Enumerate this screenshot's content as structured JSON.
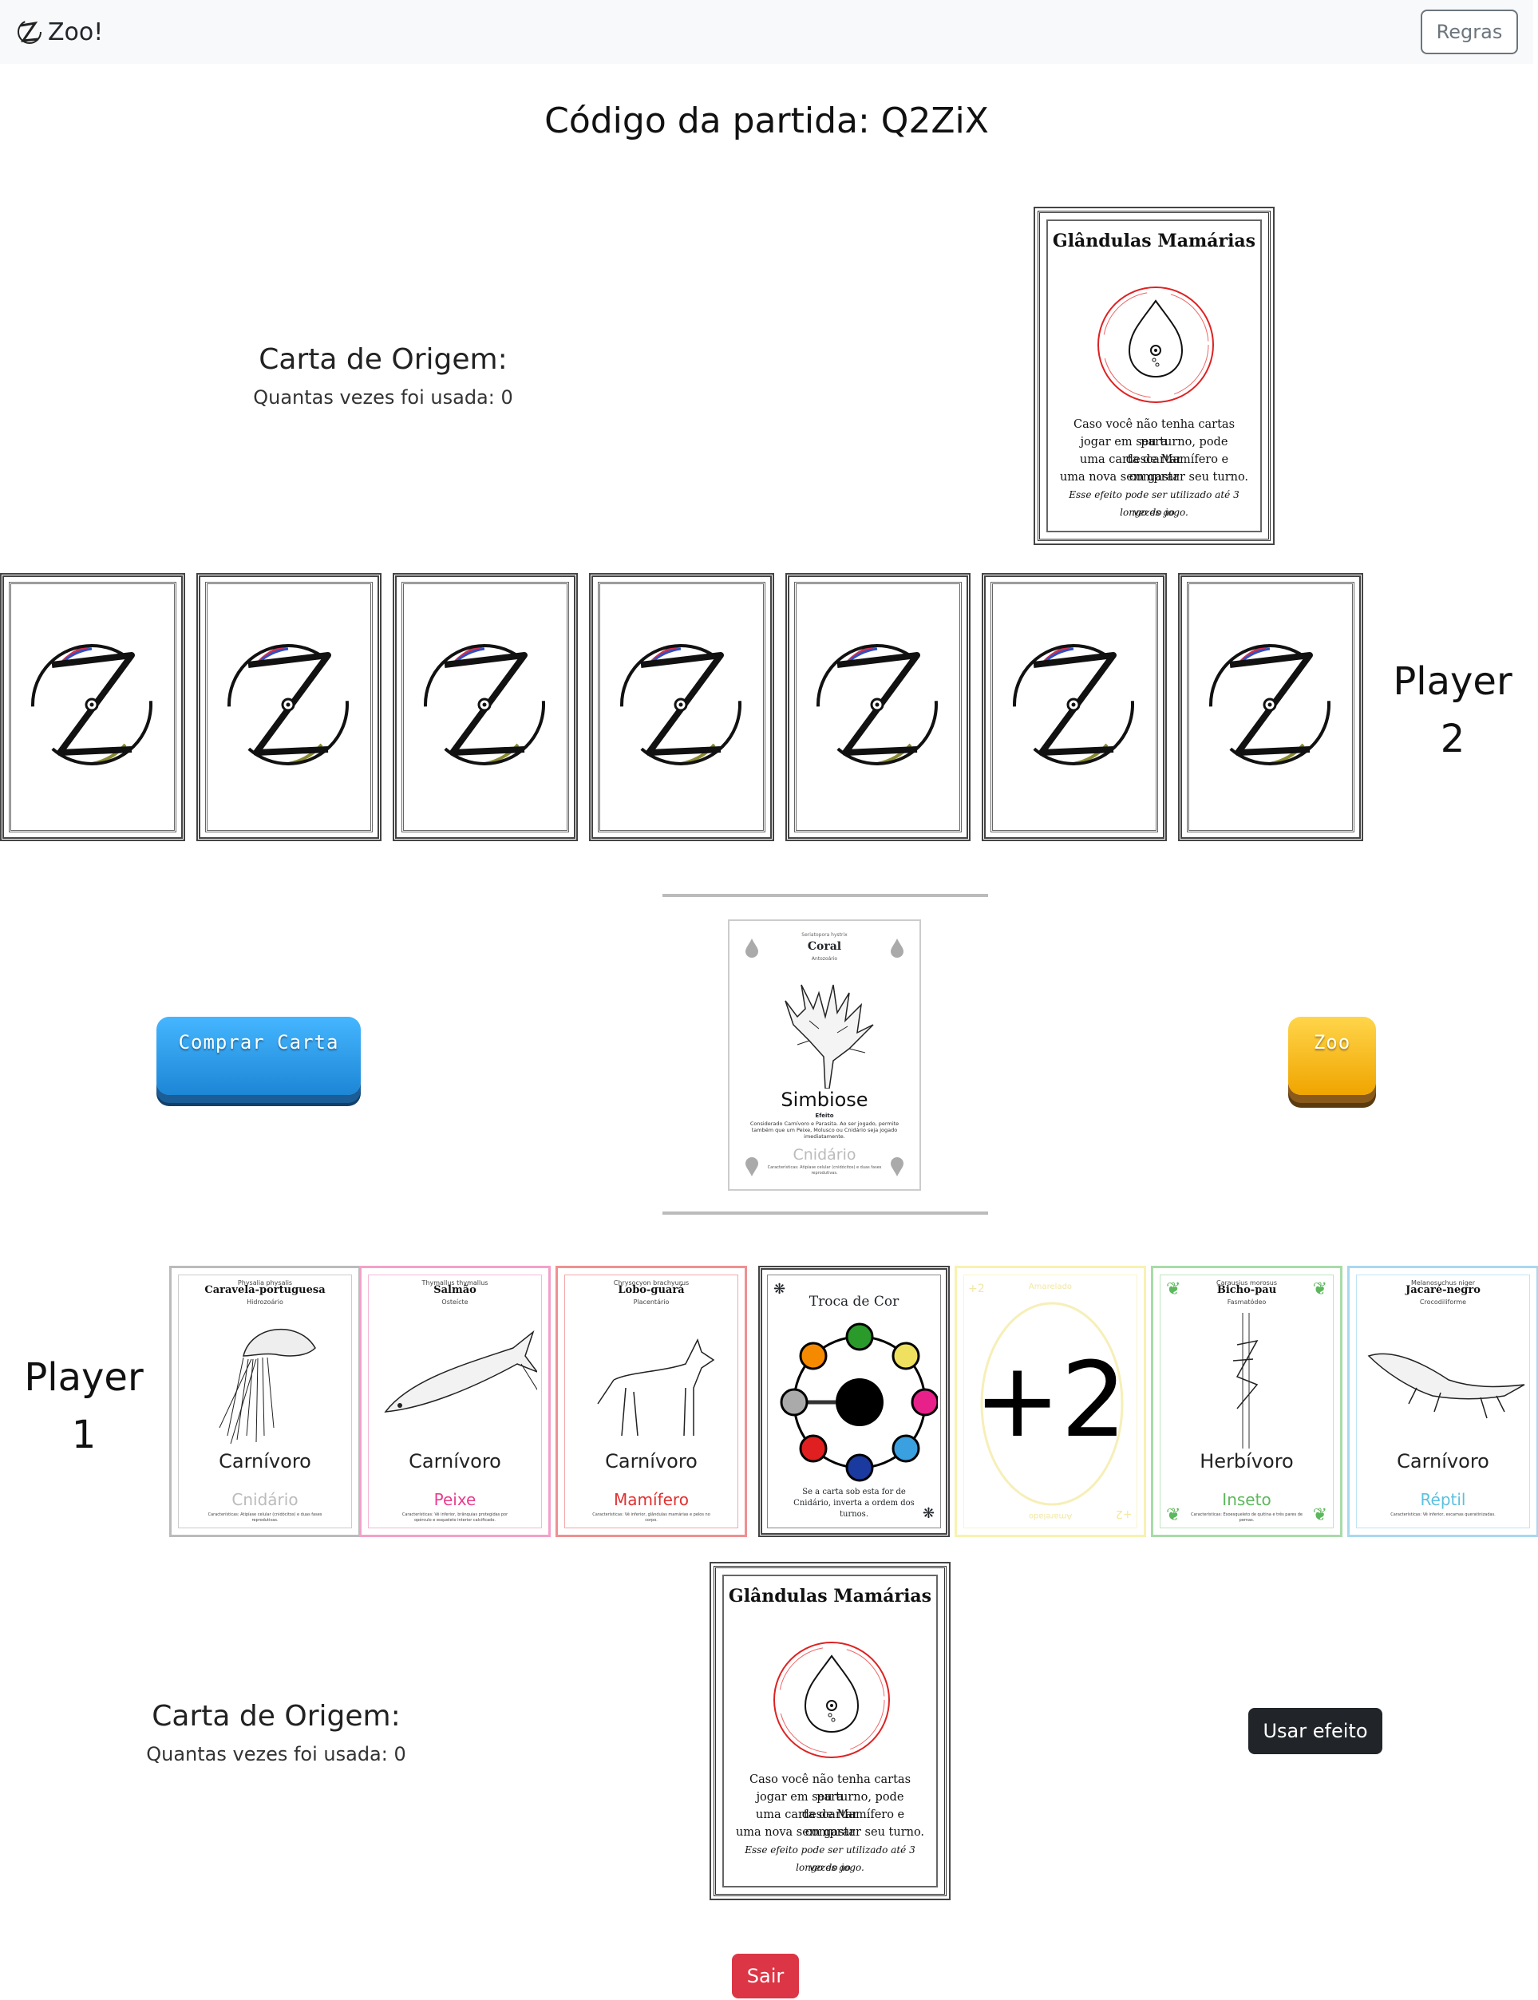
{
  "navbar": {
    "brand": "Zoo!",
    "rules_button": "Regras"
  },
  "match": {
    "code_label": "Código da partida: Q2ZiX"
  },
  "player2": {
    "name": "Player 2",
    "name_line1": "Player",
    "name_line2": "2",
    "hand_count": 7,
    "origin": {
      "title": "Carta de Origem:",
      "usage": "Quantas vezes foi usada: 0",
      "card": {
        "title": "Glândulas Mamárias",
        "text_lines": [
          "Caso você não tenha cartas para",
          "jogar em seu turno, pode descartar",
          "uma carta de Mamífero e comprar",
          "uma nova sem gastar seu turno."
        ],
        "italic_lines": [
          "Esse efeito pode ser utilizado até 3 vezes ao",
          "longo do jogo."
        ]
      }
    }
  },
  "table": {
    "buy_button": "Comprar Carta",
    "zoo_button": "Zoo",
    "top_card": {
      "sci_top": "Seriatopora hystrix",
      "name": "Coral",
      "subclass": "Antozoário",
      "effect_name": "Simbiose",
      "effect_label": "Efeito",
      "effect_text": "Considerado Carnívoro e Parasita. Ao ser jogado, permite também que um Peixe, Molusco ou Cnidário seja jogado imediatamente.",
      "class": "Cnidário",
      "class_desc": "Características: Atipíase celular (cnidócitos) e duas fases reprodutivas."
    }
  },
  "player1": {
    "name_line1": "Player",
    "name_line2": "1",
    "hand": [
      {
        "sci": "Physalia physalis",
        "name": "Caravela-portuguesa",
        "sub": "Hidrozoário",
        "diet": "Carnívoro",
        "class": "Cnidário",
        "desc": "Características: Atipíase celular (cnidócitos) e duas fases reprodutivas.",
        "color": "#bbbbbb"
      },
      {
        "sci": "Thymallus thymallus",
        "name": "Salmão",
        "sub": "Osteícte",
        "diet": "Carnívoro",
        "class": "Peixe",
        "desc": "Características: Vê inferior, brânquias protegidas por opérculo e esqueleto interior calcificado.",
        "color": "#e83e8c"
      },
      {
        "sci": "Chrysocyon brachyurus",
        "name": "Lobo-guará",
        "sub": "Placentário",
        "diet": "Carnívoro",
        "class": "Mamífero",
        "desc": "Características: Vê inferior, glândulas mamárias e pelos no corpo.",
        "color": "#e03030"
      },
      {
        "title": "Troca de Cor",
        "text": "Se a carta sob esta for de Cnidário, inverta a ordem dos turnos."
      },
      {
        "plus": "+2",
        "label": "Amarelado"
      },
      {
        "sci": "Carausius morosus",
        "name": "Bicho-pau",
        "sub": "Fasmatódeo",
        "diet": "Herbívoro",
        "class": "Inseto",
        "desc": "Características: Exoesqueleto de quitina e três pares de pernas.",
        "color": "#5cb85c"
      },
      {
        "sci": "Melanosuchus niger",
        "name": "Jacaré-negro",
        "sub": "Crocodiliforme",
        "diet": "Carnívoro",
        "class": "Réptil",
        "desc": "Características: Vê inferior, escamas queratinizadas.",
        "color": "#5bc0de"
      }
    ],
    "origin": {
      "title": "Carta de Origem:",
      "usage": "Quantas vezes foi usada: 0",
      "card": {
        "title": "Glândulas Mamárias",
        "text_lines": [
          "Caso você não tenha cartas para",
          "jogar em seu turno, pode descartar",
          "uma carta de Mamífero e comprar",
          "uma nova sem gastar seu turno."
        ],
        "italic_lines": [
          "Esse efeito pode ser utilizado até 3 vezes ao",
          "longo do jogo."
        ]
      }
    },
    "use_effect_button": "Usar efeito",
    "exit_button": "Sair"
  },
  "colors": {
    "exit": "#dc3545",
    "effect": "#212529",
    "buy": "#2b9ee8",
    "zoo": "#f5b400",
    "swap_circle": [
      "#7a7a7a",
      "#f58a00",
      "#2a9a2a",
      "#f0e060",
      "#e8208a",
      "#3aa0e0",
      "#1a3aa0",
      "#e02020"
    ]
  },
  "icons": {
    "brand": "zoo-logo-icon",
    "card_back": "zoo-logo-icon",
    "origin": "drop-icon"
  }
}
